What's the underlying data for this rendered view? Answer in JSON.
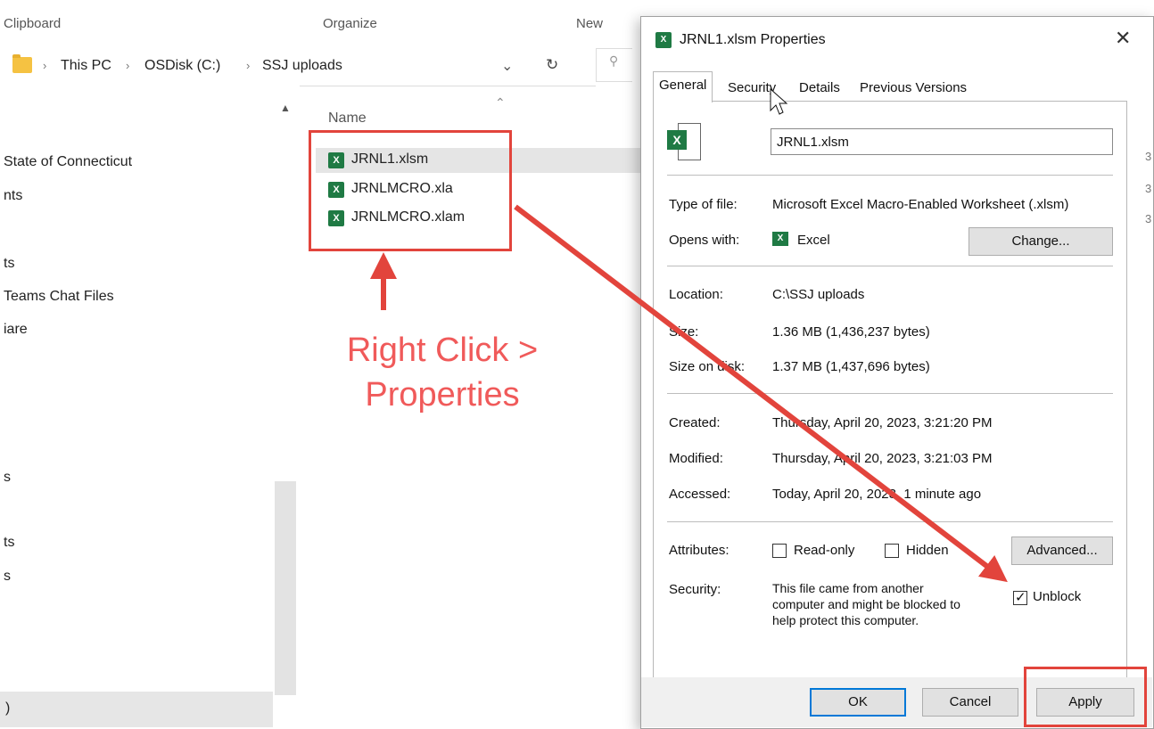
{
  "ribbon": {
    "clipboard": "Clipboard",
    "organize": "Organize",
    "new": "New"
  },
  "address": {
    "crumbs": [
      "This PC",
      "OSDisk (C:)",
      "SSJ uploads"
    ],
    "separator": "›"
  },
  "nav_pane": {
    "items": [
      "State of Connecticut",
      "nts",
      "ts",
      "Teams Chat Files",
      "iare",
      "s",
      "ts",
      "s",
      ")"
    ]
  },
  "file_list": {
    "column_name": "Name",
    "files": [
      {
        "name": "JRNL1.xlsm",
        "icon": "excel-macro-icon",
        "selected": true
      },
      {
        "name": "JRNLMCRO.xla",
        "icon": "excel-addin-icon",
        "selected": false
      },
      {
        "name": "JRNLMCRO.xlam",
        "icon": "excel-addin-icon",
        "selected": false
      }
    ]
  },
  "annotation": {
    "line1": "Right Click >",
    "line2": "Properties"
  },
  "dialog": {
    "title": "JRNL1.xlsm Properties",
    "close": "✕",
    "tabs": [
      "General",
      "Security",
      "Details",
      "Previous Versions"
    ],
    "active_tab": "General",
    "file_name": "JRNL1.xlsm",
    "type_label": "Type of file:",
    "type_value": "Microsoft Excel Macro-Enabled Worksheet (.xlsm)",
    "opens_label": "Opens with:",
    "opens_value": "Excel",
    "change_button": "Change...",
    "location_label": "Location:",
    "location_value": "C:\\SSJ uploads",
    "size_label": "Size:",
    "size_value": "1.36 MB (1,436,237 bytes)",
    "size_disk_label": "Size on disk:",
    "size_disk_value": "1.37 MB (1,437,696 bytes)",
    "created_label": "Created:",
    "created_value": "Thursday, April 20, 2023, 3:21:20 PM",
    "modified_label": "Modified:",
    "modified_value": "Thursday, April 20, 2023, 3:21:03 PM",
    "accessed_label": "Accessed:",
    "accessed_value": "Today, April 20, 2023, 1 minute ago",
    "attributes_label": "Attributes:",
    "readonly_label": "Read-only",
    "readonly_checked": false,
    "hidden_label": "Hidden",
    "hidden_checked": false,
    "advanced_button": "Advanced...",
    "security_label": "Security:",
    "security_text_1": "This file came from another",
    "security_text_2": "computer and might be blocked to",
    "security_text_3": "help protect this computer.",
    "unblock_label": "Unblock",
    "unblock_checked": true,
    "ok_button": "OK",
    "cancel_button": "Cancel",
    "apply_button": "Apply"
  },
  "colors": {
    "highlight_red": "#e2443c",
    "annotation_red": "#f05a5a",
    "excel_green": "#1f7a44",
    "focus_blue": "#0078d7"
  }
}
